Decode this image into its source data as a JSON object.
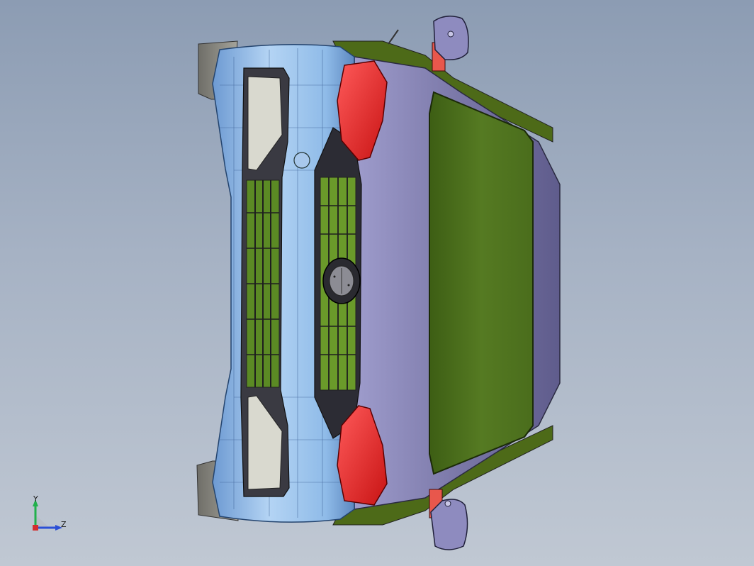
{
  "viewport": {
    "background_top": "#8c9cb3",
    "background_bottom": "#c0c8d3"
  },
  "model": {
    "description_icon": "car-front-model",
    "colors": {
      "bumper": "#8fbbe8",
      "bumper_edge": "#5d88c0",
      "hood": "#7b78a8",
      "windshield": "#4e6e1e",
      "headlight": "#e42b2b",
      "mirror_arm": "#e8574c",
      "grille_insert": "#6a9a2a",
      "fender_liner": "#8a8880"
    }
  },
  "triad": {
    "y_label": "Y",
    "z_label": "Z",
    "y_color": "#22b14c",
    "z_color": "#2b4fd6"
  }
}
